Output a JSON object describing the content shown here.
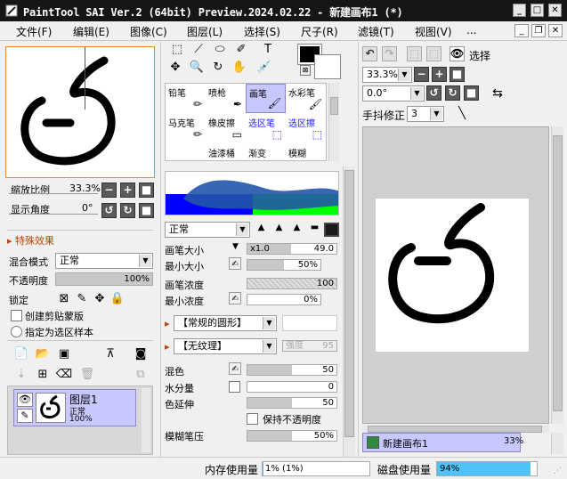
{
  "window": {
    "title": "PaintTool SAI Ver.2 (64bit) Preview.2024.02.22 - 新建画布1 (*)",
    "min": "_",
    "max": "□",
    "close": "✕"
  },
  "menu": [
    "文件(F)",
    "编辑(E)",
    "图像(C)",
    "图层(L)",
    "选择(S)",
    "尺子(R)",
    "滤镜(T)",
    "视图(V)",
    "..."
  ],
  "navigator": {
    "zoom_label": "缩放比例",
    "zoom_value": "33.3%",
    "angle_label": "显示角度",
    "angle_value": "0°"
  },
  "effects": {
    "title": "特殊效果",
    "blend_label": "混合模式",
    "blend_value": "正常",
    "opacity_label": "不透明度",
    "opacity_value": "100%",
    "opacity_fraction": 1.0,
    "lock_label": "锁定",
    "clip_label": "创建剪贴蒙版",
    "sample_label": "指定为选区样本"
  },
  "layer": {
    "name": "图层1",
    "mode": "正常",
    "opacity": "100%"
  },
  "tools": {
    "row1": [
      "铅笔",
      "喷枪",
      "画笔",
      "水彩笔"
    ],
    "row2": [
      "马克笔",
      "橡皮擦",
      "选区笔",
      "选区擦"
    ],
    "row3": [
      "油漆桶",
      "渐变",
      "模糊"
    ]
  },
  "brush": {
    "mode_value": "正常",
    "size_label": "画笔大小",
    "size_mult": "x1.0",
    "size_value": "49.0",
    "size_fraction": 0.49,
    "minsize_label": "最小大小",
    "minsize_value": "50%",
    "minsize_fraction": 0.5,
    "density_label": "画笔浓度",
    "density_value": "100",
    "density_fraction": 1.0,
    "mindensity_label": "最小浓度",
    "mindensity_value": "0%",
    "shape_value": "【常规的圆形】",
    "texture_value": "【无纹理】",
    "texture_strength": "强度",
    "texture_strength_value": "95",
    "mix_label": "混色",
    "mix_value": "50",
    "mix_fraction": 0.5,
    "water_label": "水分量",
    "water_value": "0",
    "stretch_label": "色延伸",
    "stretch_value": "50",
    "stretch_fraction": 0.5,
    "keep_opacity_label": "保持不透明度",
    "blur_label": "模糊笔压",
    "blur_value": "50%",
    "blur_fraction": 0.5
  },
  "view": {
    "select_label": "选择",
    "zoom_value": "33.3%",
    "angle_value": "0.0°",
    "stabilizer_label": "手抖修正",
    "stabilizer_value": "3"
  },
  "canvas_tab": {
    "name": "新建画布1",
    "zoom": "33%"
  },
  "status": {
    "memory_label": "内存使用量",
    "memory_value": "1% (1%)",
    "memory_fraction": 0.01,
    "disk_label": "磁盘使用量",
    "disk_value": "94%",
    "disk_fraction": 0.94
  },
  "colors": {
    "accent": "#c8c8ff",
    "disk_fill": "#4fc3f7",
    "titlebar": "#161616",
    "section_title": "#c04000"
  }
}
